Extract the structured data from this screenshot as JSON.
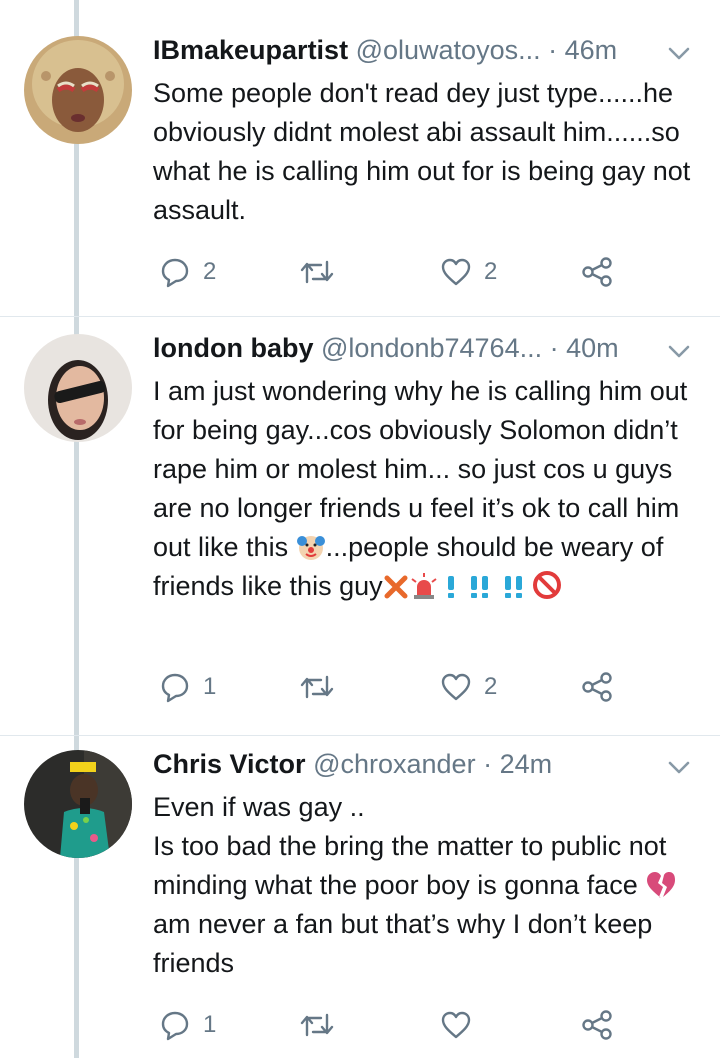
{
  "tweets": [
    {
      "name": "IBmakeupartist",
      "handle": "@oluwatoyos...",
      "time": "· 46m",
      "text": "Some people don't read dey just type......he obviously didnt molest abi assault him......so what he is calling him out for is being gay not assault.",
      "replies": "2",
      "retweets": "",
      "likes": "2"
    },
    {
      "name": "london baby",
      "handle": "@londonb74764...",
      "time": "· 40m",
      "text_main": "I am just wondering why he is calling him out for being gay...cos obviously Solomon didn’t rape him or molest him... so just cos u guys are no longer friends u feel it’s ok to call him out like this",
      "text_tail_a": "...people  should be weary of friends like this guy",
      "emoji_names": [
        "clown-face-emoji",
        "cross-mark-emoji",
        "rotating-light-emoji",
        "exclamation-emoji",
        "double-exclamation-emoji",
        "double-exclamation-emoji",
        "prohibited-emoji"
      ],
      "replies": "1",
      "retweets": "",
      "likes": "2"
    },
    {
      "name": "Chris Victor",
      "handle": "@chroxander",
      "time": "· 24m",
      "line1": "Even if was gay ..",
      "line2a": "Is too bad the bring the matter to public not minding what the poor boy is gonna face",
      "line2b": "am never a fan but that’s why I don’t keep friends",
      "emoji_names": [
        "broken-heart-emoji"
      ],
      "replies": "1",
      "retweets": "",
      "likes": ""
    }
  ],
  "colors": {
    "text": "#14171a",
    "secondary": "#657786",
    "divider": "#e1e8ed",
    "thread_line": "#cfd9de"
  },
  "icons": [
    "reply-icon",
    "retweet-icon",
    "like-icon",
    "share-icon",
    "chevron-down-icon"
  ]
}
